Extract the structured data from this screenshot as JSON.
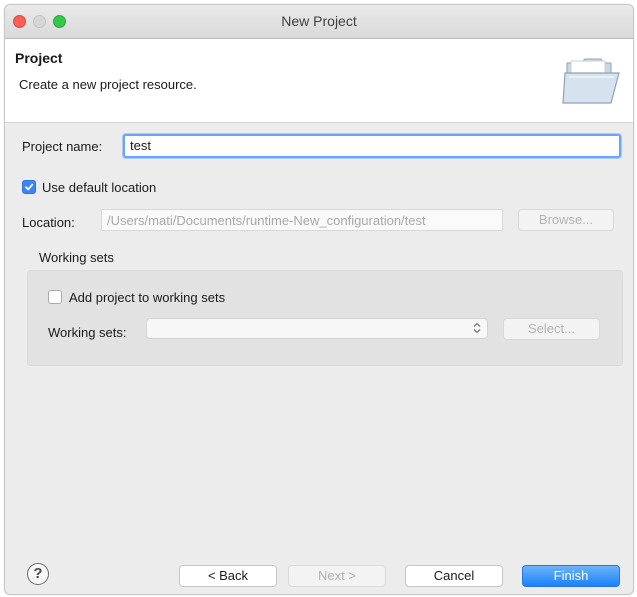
{
  "window": {
    "title": "New Project"
  },
  "header": {
    "title": "Project",
    "description": "Create a new project resource."
  },
  "form": {
    "project_name_label": "Project name:",
    "project_name_value": "test",
    "use_default_location_label": "Use default location",
    "use_default_location_checked": true,
    "location_label": "Location:",
    "location_value": "/Users/mati/Documents/runtime-New_configuration/test",
    "browse_label": "Browse..."
  },
  "working_sets": {
    "group_title": "Working sets",
    "add_label": "Add project to working sets",
    "add_checked": false,
    "sets_label": "Working sets:",
    "sets_value": "",
    "select_label": "Select..."
  },
  "footer": {
    "help_symbol": "?",
    "back_label": "< Back",
    "next_label": "Next >",
    "cancel_label": "Cancel",
    "finish_label": "Finish"
  },
  "colors": {
    "accent": "#1a82fb",
    "focus_ring": "#6aa5f7",
    "close": "#fc5f57",
    "maximize": "#34c84a"
  }
}
